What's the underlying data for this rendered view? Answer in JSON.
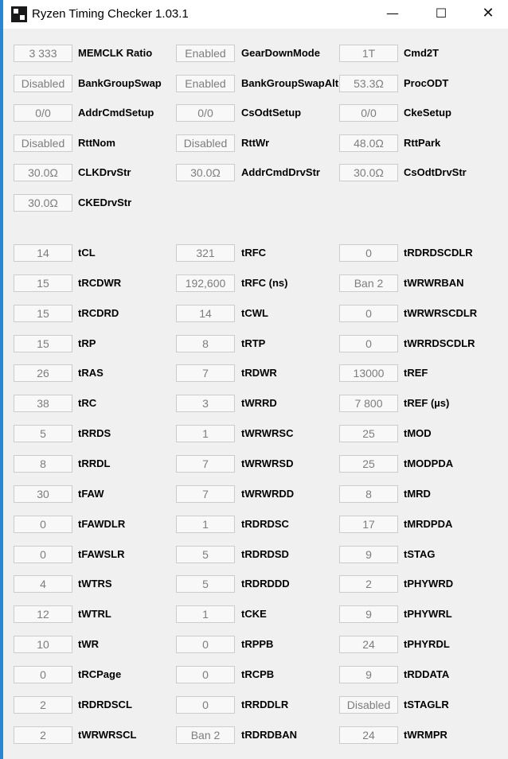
{
  "window": {
    "title": "Ryzen Timing Checker 1.03.1",
    "minimize_glyph": "—",
    "maximize_glyph": "☐",
    "close_glyph": "✕",
    "accent_color": "#2b86d1"
  },
  "settings_rows": [
    [
      {
        "value": "3 333",
        "label": "MEMCLK Ratio"
      },
      {
        "value": "Enabled",
        "label": "GearDownMode"
      },
      {
        "value": "1T",
        "label": "Cmd2T"
      }
    ],
    [
      {
        "value": "Disabled",
        "label": "BankGroupSwap"
      },
      {
        "value": "Enabled",
        "label": "BankGroupSwapAlt"
      },
      {
        "value": "53.3Ω",
        "label": "ProcODT"
      }
    ],
    [
      {
        "value": "0/0",
        "label": "AddrCmdSetup"
      },
      {
        "value": "0/0",
        "label": "CsOdtSetup"
      },
      {
        "value": "0/0",
        "label": "CkeSetup"
      }
    ],
    [
      {
        "value": "Disabled",
        "label": "RttNom"
      },
      {
        "value": "Disabled",
        "label": "RttWr"
      },
      {
        "value": "48.0Ω",
        "label": "RttPark"
      }
    ],
    [
      {
        "value": "30.0Ω",
        "label": "CLKDrvStr"
      },
      {
        "value": "30.0Ω",
        "label": "AddrCmdDrvStr"
      },
      {
        "value": "30.0Ω",
        "label": "CsOdtDrvStr"
      }
    ],
    [
      {
        "value": "30.0Ω",
        "label": "CKEDrvStr"
      }
    ]
  ],
  "timing_rows": [
    [
      {
        "value": "14",
        "label": "tCL"
      },
      {
        "value": "321",
        "label": "tRFC"
      },
      {
        "value": "0",
        "label": "tRDRDSCDLR"
      }
    ],
    [
      {
        "value": "15",
        "label": "tRCDWR"
      },
      {
        "value": "192,600",
        "label": "tRFC (ns)"
      },
      {
        "value": "Ban 2",
        "label": "tWRWRBAN"
      }
    ],
    [
      {
        "value": "15",
        "label": "tRCDRD"
      },
      {
        "value": "14",
        "label": "tCWL"
      },
      {
        "value": "0",
        "label": "tWRWRSCDLR"
      }
    ],
    [
      {
        "value": "15",
        "label": "tRP"
      },
      {
        "value": "8",
        "label": "tRTP"
      },
      {
        "value": "0",
        "label": "tWRRDSCDLR"
      }
    ],
    [
      {
        "value": "26",
        "label": "tRAS"
      },
      {
        "value": "7",
        "label": "tRDWR"
      },
      {
        "value": "13000",
        "label": "tREF"
      }
    ],
    [
      {
        "value": "38",
        "label": "tRC"
      },
      {
        "value": "3",
        "label": "tWRRD"
      },
      {
        "value": "7 800",
        "label": "tREF (µs)"
      }
    ],
    [
      {
        "value": "5",
        "label": "tRRDS"
      },
      {
        "value": "1",
        "label": "tWRWRSC"
      },
      {
        "value": "25",
        "label": "tMOD"
      }
    ],
    [
      {
        "value": "8",
        "label": "tRRDL"
      },
      {
        "value": "7",
        "label": "tWRWRSD"
      },
      {
        "value": "25",
        "label": "tMODPDA"
      }
    ],
    [
      {
        "value": "30",
        "label": "tFAW"
      },
      {
        "value": "7",
        "label": "tWRWRDD"
      },
      {
        "value": "8",
        "label": "tMRD"
      }
    ],
    [
      {
        "value": "0",
        "label": "tFAWDLR"
      },
      {
        "value": "1",
        "label": "tRDRDSC"
      },
      {
        "value": "17",
        "label": "tMRDPDA"
      }
    ],
    [
      {
        "value": "0",
        "label": "tFAWSLR"
      },
      {
        "value": "5",
        "label": "tRDRDSD"
      },
      {
        "value": "9",
        "label": "tSTAG"
      }
    ],
    [
      {
        "value": "4",
        "label": "tWTRS"
      },
      {
        "value": "5",
        "label": "tRDRDDD"
      },
      {
        "value": "2",
        "label": "tPHYWRD"
      }
    ],
    [
      {
        "value": "12",
        "label": "tWTRL"
      },
      {
        "value": "1",
        "label": "tCKE"
      },
      {
        "value": "9",
        "label": "tPHYWRL"
      }
    ],
    [
      {
        "value": "10",
        "label": "tWR"
      },
      {
        "value": "0",
        "label": "tRPPB"
      },
      {
        "value": "24",
        "label": "tPHYRDL"
      }
    ],
    [
      {
        "value": "0",
        "label": "tRCPage"
      },
      {
        "value": "0",
        "label": "tRCPB"
      },
      {
        "value": "9",
        "label": "tRDDATA"
      }
    ],
    [
      {
        "value": "2",
        "label": "tRDRDSCL"
      },
      {
        "value": "0",
        "label": "tRRDDLR"
      },
      {
        "value": "Disabled",
        "label": "tSTAGLR"
      }
    ],
    [
      {
        "value": "2",
        "label": "tWRWRSCL"
      },
      {
        "value": "Ban 2",
        "label": "tRDRDBAN"
      },
      {
        "value": "24",
        "label": "tWRMPR"
      }
    ]
  ]
}
